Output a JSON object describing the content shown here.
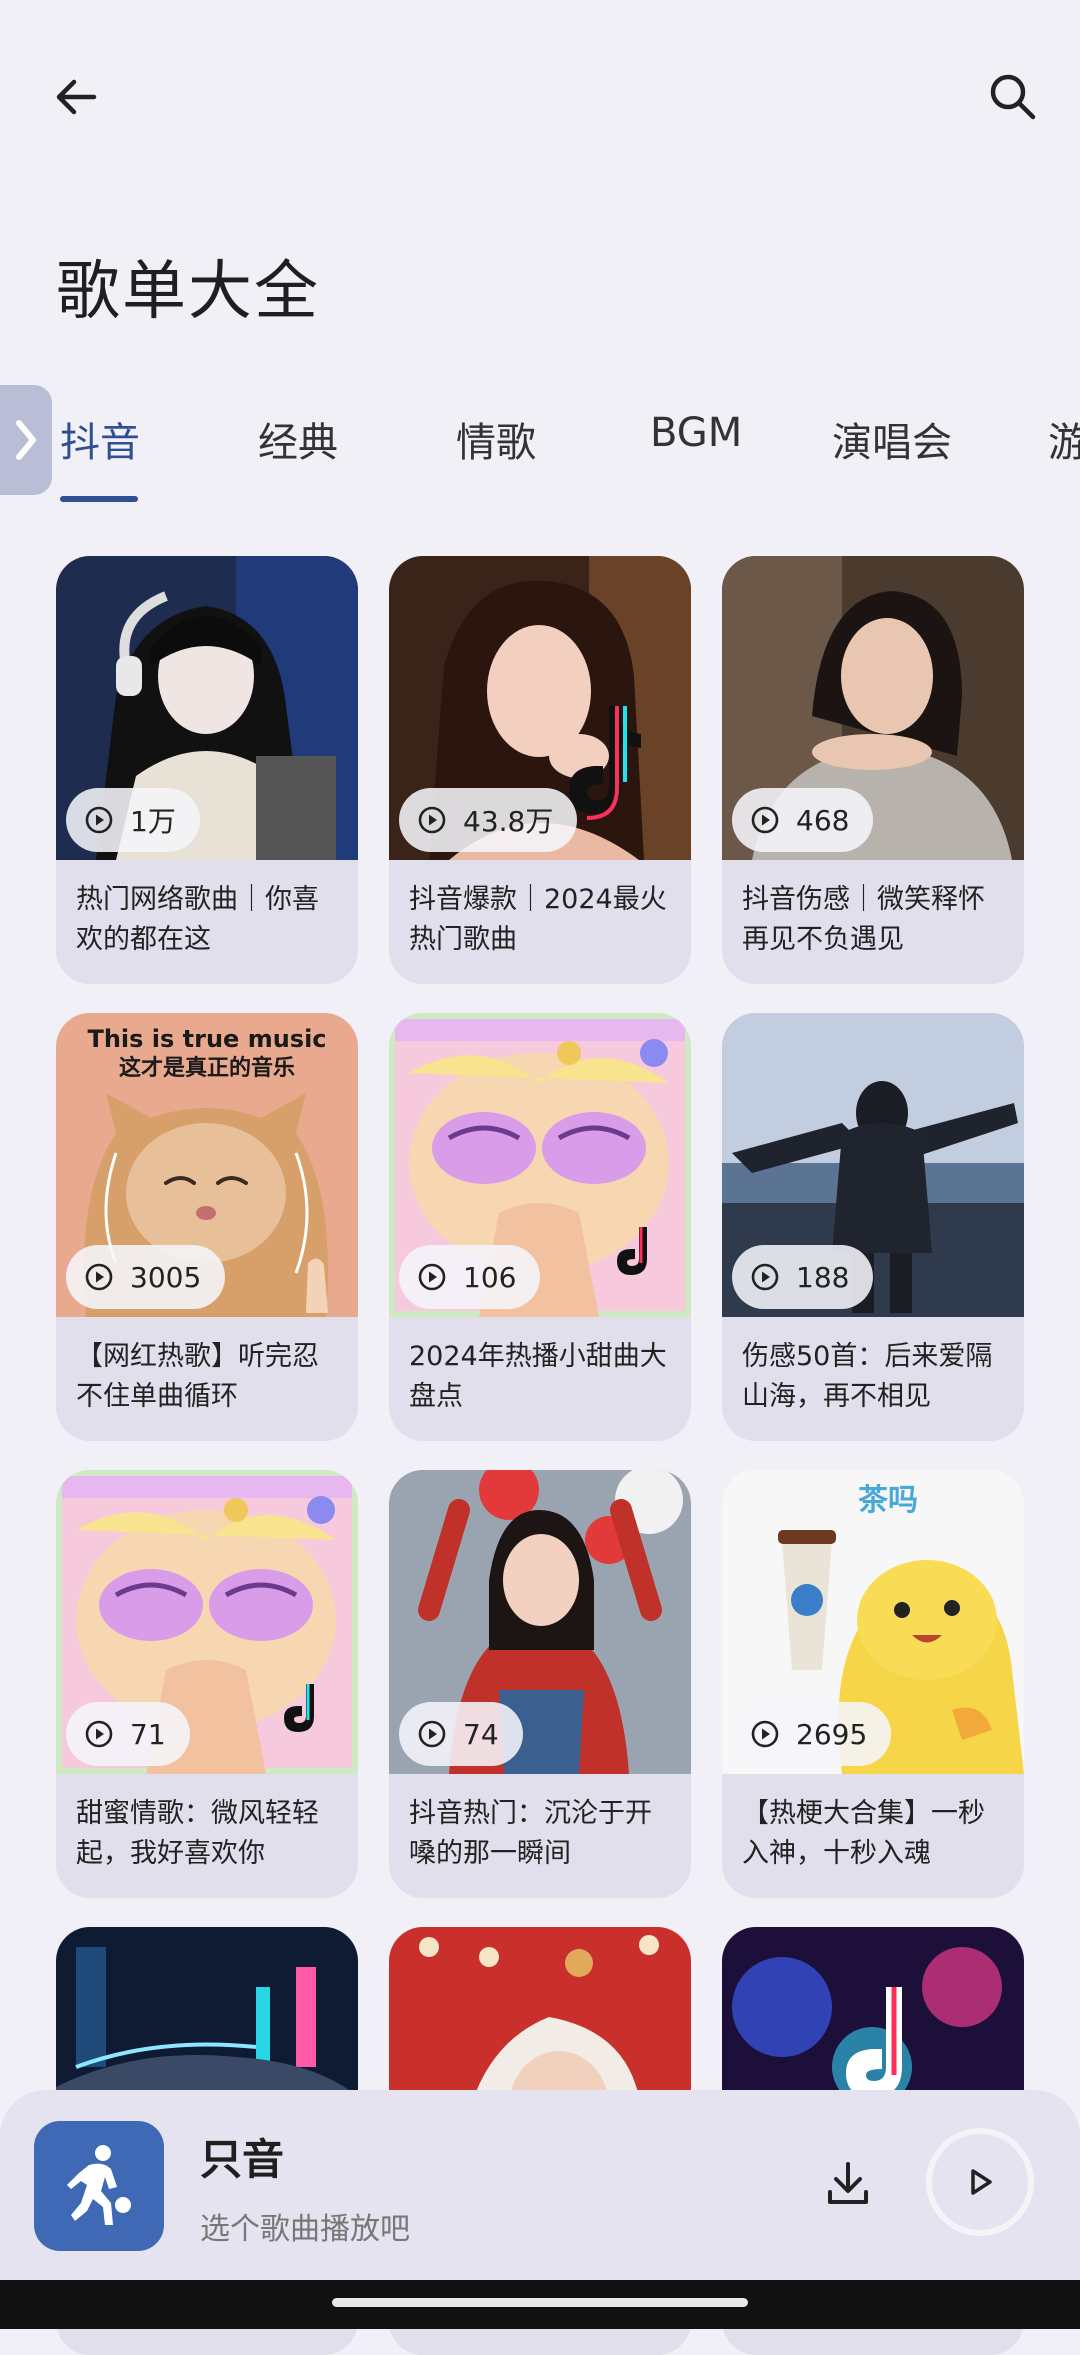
{
  "header": {
    "title": "歌单大全",
    "back_icon": "arrow-left-icon",
    "search_icon": "search-icon"
  },
  "tabs": [
    {
      "label": "抖音",
      "active": true
    },
    {
      "label": "经典",
      "active": false
    },
    {
      "label": "情歌",
      "active": false
    },
    {
      "label": "BGM",
      "active": false
    },
    {
      "label": "演唱会",
      "active": false
    },
    {
      "label": "游",
      "active": false
    }
  ],
  "playlists": [
    {
      "title": "热门网络歌曲｜你喜欢的都在这",
      "plays": "1万"
    },
    {
      "title": "抖音爆款｜2024最火热门歌曲",
      "plays": "43.8万"
    },
    {
      "title": "抖音伤感｜微笑释怀再见不负遇见",
      "plays": "468"
    },
    {
      "title": "【网红热歌】听完忍不住单曲循环",
      "plays": "3005"
    },
    {
      "title": "2024年热播小甜曲大盘点",
      "plays": "106"
    },
    {
      "title": "伤感50首：后来爱隔山海，再不相见",
      "plays": "188"
    },
    {
      "title": "甜蜜情歌：微风轻轻起，我好喜欢你",
      "plays": "71"
    },
    {
      "title": "抖音热门：沉沦于开嗓的那一瞬间",
      "plays": "74"
    },
    {
      "title": "【热梗大合集】一秒入神，十秒入魂",
      "plays": "2695"
    },
    {
      "title": "",
      "plays": ""
    },
    {
      "title": "",
      "plays": ""
    },
    {
      "title": "",
      "plays": ""
    }
  ],
  "cover_texts": {
    "cat_line1": "This is true music",
    "cat_line2": "这才是真正的音乐",
    "milktea": "茶吗"
  },
  "player": {
    "name": "只音",
    "subtitle": "选个歌曲播放吧",
    "thumb_icon": "basketball-player-icon",
    "download_icon": "download-icon",
    "play_icon": "play-icon"
  },
  "colors": {
    "accent": "#2f4f92",
    "background": "#f1f0f7",
    "card": "#e0dfeb",
    "player_thumb": "#3f69b4"
  }
}
